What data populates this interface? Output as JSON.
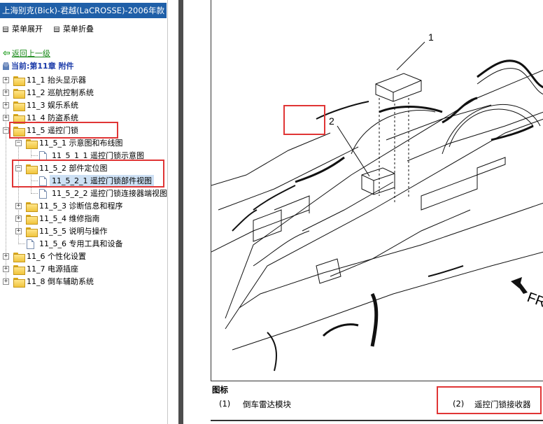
{
  "window": {
    "title": "上海别克(Bick)-君越(LaCROSSE)-2006年款"
  },
  "toolbar": {
    "expand_label": "菜单展开",
    "collapse_label": "菜单折叠"
  },
  "nav": {
    "back_label": "返回上一级",
    "current_label": "当前:第11章 附件"
  },
  "tree": {
    "n11_1": "11_1 抬头显示器",
    "n11_2": "11_2 巡航控制系统",
    "n11_3": "11_3 娱乐系统",
    "n11_4": "11_4 防盗系统",
    "n11_5": "11_5 遥控门锁",
    "n11_5_1": "11_5_1 示意图和布线图",
    "n11_5_1_1": "11_5_1_1 遥控门锁示意图",
    "n11_5_2": "11_5_2 部件定位图",
    "n11_5_2_1": "11_5_2_1 遥控门锁部件视图",
    "n11_5_2_2": "11_5_2_2 遥控门锁连接器端视图",
    "n11_5_3": "11_5_3 诊断信息和程序",
    "n11_5_4": "11_5_4 维修指南",
    "n11_5_5": "11_5_5 说明与操作",
    "n11_5_6": "11_5_6 专用工具和设备",
    "n11_6": "11_6 个性化设置",
    "n11_7": "11_7 电源插座",
    "n11_8": "11_8 倒车辅助系统"
  },
  "figure": {
    "callout_1": "1",
    "callout_2": "2",
    "direction": "FRT"
  },
  "legend": {
    "title": "图标",
    "items": [
      {
        "num": "(1)",
        "label": "倒车雷达模块"
      },
      {
        "num": "(2)",
        "label": "遥控门锁接收器"
      }
    ]
  }
}
